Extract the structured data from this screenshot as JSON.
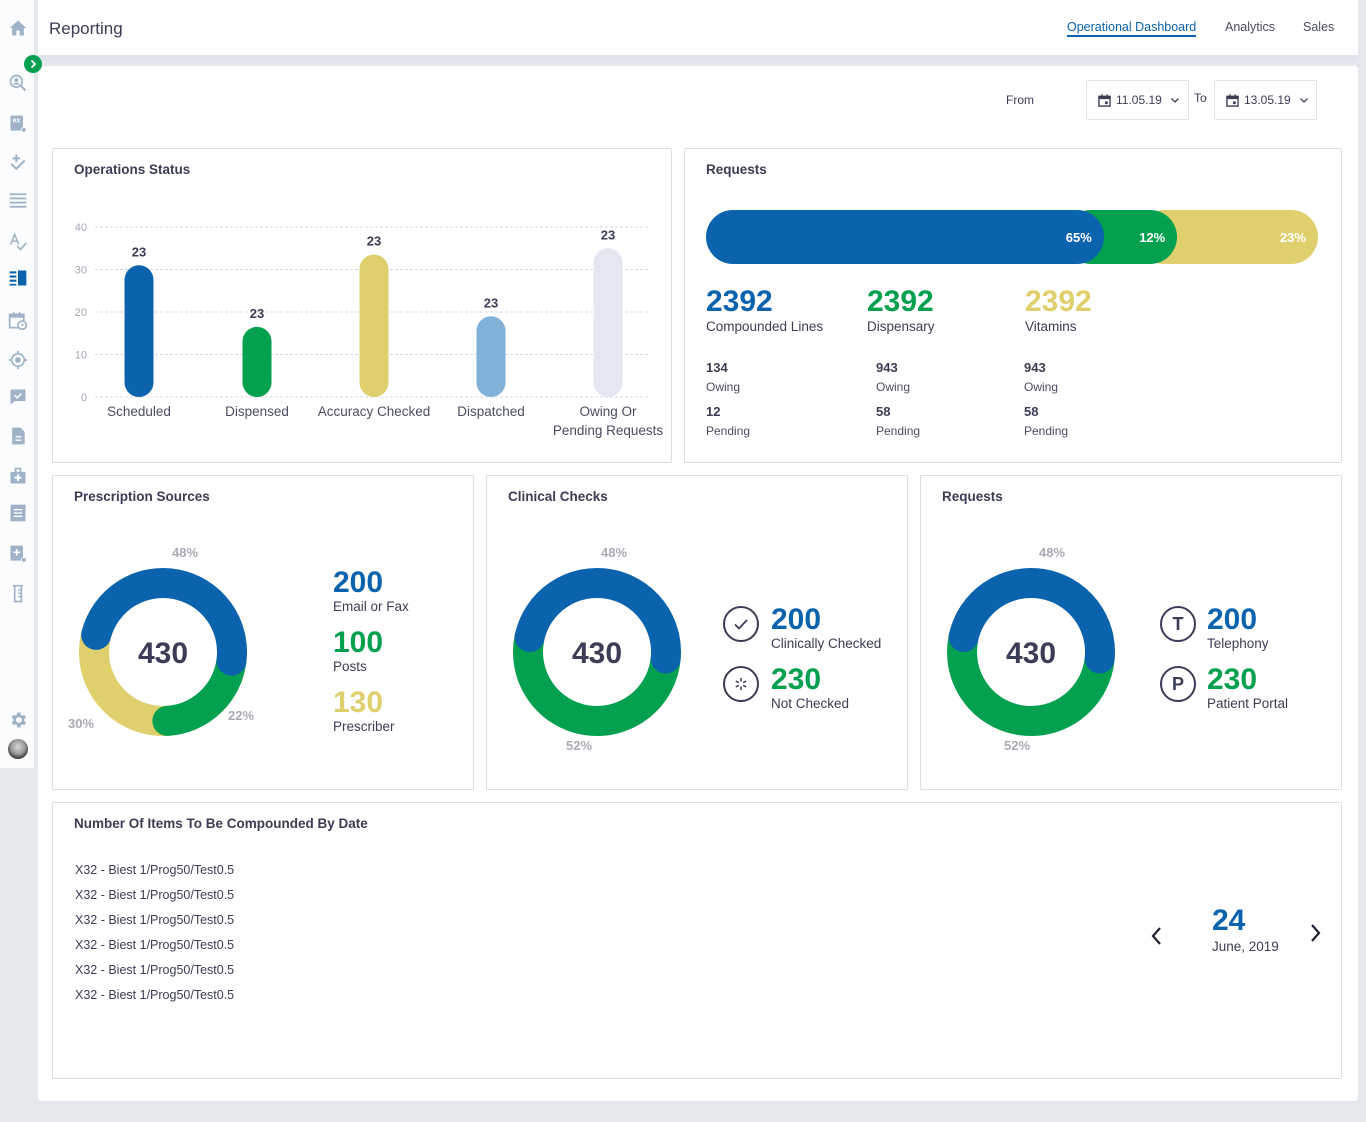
{
  "colors": {
    "blue": "#0b63ad",
    "green": "#03a04f",
    "yellow": "#dfd06d",
    "light_blue": "#82b1d8",
    "lavender": "#e4e6f2",
    "sidebar_icon": "#9fb2c8",
    "sidebar_active": "#0b63ad",
    "expand_button": "#03a04f"
  },
  "sidebar": {
    "items": [
      {
        "icon": "home-icon"
      },
      {
        "icon": "patient-search-icon"
      },
      {
        "icon": "rx-settings-icon"
      },
      {
        "icon": "add-check-icon"
      },
      {
        "icon": "list-icon"
      },
      {
        "icon": "spellcheck-icon"
      },
      {
        "icon": "reporting-icon",
        "active": true
      },
      {
        "icon": "calendar-clock-icon"
      },
      {
        "icon": "target-icon"
      },
      {
        "icon": "message-check-icon"
      },
      {
        "icon": "document-icon"
      },
      {
        "icon": "medical-kit-icon"
      },
      {
        "icon": "receipt-icon"
      },
      {
        "icon": "add-document-settings-icon"
      },
      {
        "icon": "test-tube-icon"
      }
    ],
    "settings_icon": "gear-icon",
    "avatar": "user-avatar"
  },
  "header": {
    "title": "Reporting",
    "tabs": [
      {
        "label": "Operational Dashboard",
        "active": true
      },
      {
        "label": "Analytics",
        "active": false
      },
      {
        "label": "Sales",
        "active": false
      }
    ]
  },
  "filters": {
    "from_label": "From",
    "from_value": "11.05.19",
    "to_label": "To",
    "to_value": "13.05.19"
  },
  "operations_status": {
    "title": "Operations Status"
  },
  "requests_summary": {
    "title": "Requests",
    "segments": [
      {
        "label": "65%",
        "value": 65,
        "color": "#0b63ad"
      },
      {
        "label": "12%",
        "value": 12,
        "color": "#03a04f"
      },
      {
        "label": "23%",
        "value": 23,
        "color": "#dfd06d"
      }
    ],
    "groups": [
      {
        "total": "2392",
        "name": "Compounded Lines",
        "color": "#0b63ad",
        "owing": "134",
        "owing_label": "Owing",
        "pending": "12",
        "pending_label": "Pending"
      },
      {
        "total": "2392",
        "name": "Dispensary",
        "color": "#03a04f",
        "owing": "943",
        "owing_label": "Owing",
        "pending": "58",
        "pending_label": "Pending"
      },
      {
        "total": "2392",
        "name": "Vitamins",
        "color": "#dfd06d",
        "owing": "943",
        "owing_label": "Owing",
        "pending": "58",
        "pending_label": "Pending"
      }
    ]
  },
  "prescription_sources": {
    "title": "Prescription Sources",
    "total": "430",
    "slices": [
      {
        "label": "Email or Fax",
        "value": "200",
        "pct": "48%",
        "percent": 48,
        "color": "#0b63ad"
      },
      {
        "label": "Posts",
        "value": "100",
        "pct": "22%",
        "percent": 22,
        "color": "#03a04f"
      },
      {
        "label": "Prescriber",
        "value": "130",
        "pct": "30%",
        "percent": 30,
        "color": "#dfd06d"
      }
    ]
  },
  "clinical_checks": {
    "title": "Clinical Checks",
    "total": "430",
    "slices": [
      {
        "label": "Clinically Checked",
        "value": "200",
        "pct": "48%",
        "percent": 48,
        "color": "#0b63ad",
        "icon": "check-circle-icon"
      },
      {
        "label": "Not Checked",
        "value": "230",
        "pct": "52%",
        "percent": 52,
        "color": "#03a04f",
        "icon": "pending-circle-icon"
      }
    ]
  },
  "requests_channels": {
    "title": "Requests",
    "total": "430",
    "slices": [
      {
        "label": "Telephony",
        "value": "200",
        "pct": "48%",
        "percent": 48,
        "color": "#0b63ad",
        "icon": "telephony-icon",
        "letter": "T"
      },
      {
        "label": "Patient Portal",
        "value": "230",
        "pct": "52%",
        "percent": 52,
        "color": "#03a04f",
        "icon": "patient-portal-icon",
        "letter": "P"
      }
    ]
  },
  "compounded_items": {
    "title": "Number Of Items To Be Compounded By Date",
    "items": [
      "X32 - Biest 1/Prog50/Test0.5",
      "X32 - Biest 1/Prog50/Test0.5",
      "X32 - Biest 1/Prog50/Test0.5",
      "X32 - Biest 1/Prog50/Test0.5",
      "X32 - Biest 1/Prog50/Test0.5",
      "X32 - Biest 1/Prog50/Test0.5"
    ],
    "date_day": "24",
    "date_month_year": "June, 2019"
  },
  "chart_data": {
    "type": "bar",
    "title": "Operations Status",
    "categories": [
      "Scheduled",
      "Dispensed",
      "Accuracy Checked",
      "Dispatched",
      "Owing Or Pending Requests"
    ],
    "category_lines": [
      [
        "Scheduled"
      ],
      [
        "Dispensed"
      ],
      [
        "Accuracy Checked"
      ],
      [
        "Dispatched"
      ],
      [
        "Owing Or",
        "Pending Requests"
      ]
    ],
    "values": [
      31,
      16.5,
      33.5,
      19,
      35
    ],
    "data_labels": [
      "23",
      "23",
      "23",
      "23",
      "23"
    ],
    "colors": [
      "#0b63ad",
      "#03a04f",
      "#dfd06d",
      "#82b1d8",
      "#e4e6f2"
    ],
    "yticks": [
      0,
      10,
      20,
      30,
      40
    ],
    "ylim": [
      0,
      40
    ],
    "xlabel": "",
    "ylabel": "",
    "grid": true
  }
}
